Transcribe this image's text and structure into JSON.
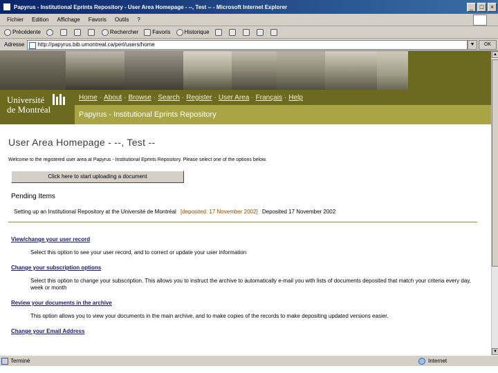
{
  "window": {
    "title": "Papyrus - Institutional Eprints Repository - User Area Homepage - --, Test -- - Microsoft Internet Explorer",
    "controls": [
      "_",
      "□",
      "×"
    ]
  },
  "menu": [
    "Fichier",
    "Edition",
    "Affichage",
    "Favoris",
    "Outils",
    "?"
  ],
  "toolbar": {
    "back": "Précédente",
    "search": "Rechercher",
    "favorites": "Favoris",
    "history": "Historique"
  },
  "address": {
    "label": "Adresse",
    "url": "http://papyrus.bib.umontreal.ca/perl/users/home",
    "go": "OK"
  },
  "logo": {
    "line1": "Université",
    "line2": "de Montréal"
  },
  "nav": {
    "items": [
      "Home",
      "About",
      "Browse",
      "Search",
      "Register",
      "User Area",
      "Français",
      "Help"
    ]
  },
  "site_subtitle": "Papyrus - Institutional Eprints Repository",
  "main": {
    "title": "User Area Homepage - --, Test --",
    "intro": "Welcome to the registered user area at Papyrus - Institutional Eprints Repository. Please select one of the options below.",
    "deposit_button": "Click here to start uploading a document",
    "pending_heading": "Pending Items",
    "pending": {
      "title": "Setting up an Institutional Repository at the Université de Montréal",
      "deposited_tag": "[deposited: 17 November 2002]",
      "deposited_text": "Deposited 17 November 2002"
    },
    "options": [
      {
        "link": "View/change your user record",
        "desc": "Select this option to see your user record, and to correct or update your user information"
      },
      {
        "link": "Change your subscription options",
        "desc": "Select this option to change your subscription. This allows you to instruct the archive to automatically e-mail you with lists of documents deposited that match your criteria every day, week or month"
      },
      {
        "link": "Review your documents in the archive",
        "desc": "This option allows you to view your documents in the main archive, and to make copies of the records to make depositing updated versions easier."
      },
      {
        "link": "Change your Email Address",
        "desc": ""
      }
    ]
  },
  "status": {
    "left": "Terminé",
    "zone": "Internet"
  },
  "colors": {
    "banner_olive": "#6b6a1e",
    "subtitle_olive": "#a9a445",
    "link_blue": "#1a1a6a"
  }
}
